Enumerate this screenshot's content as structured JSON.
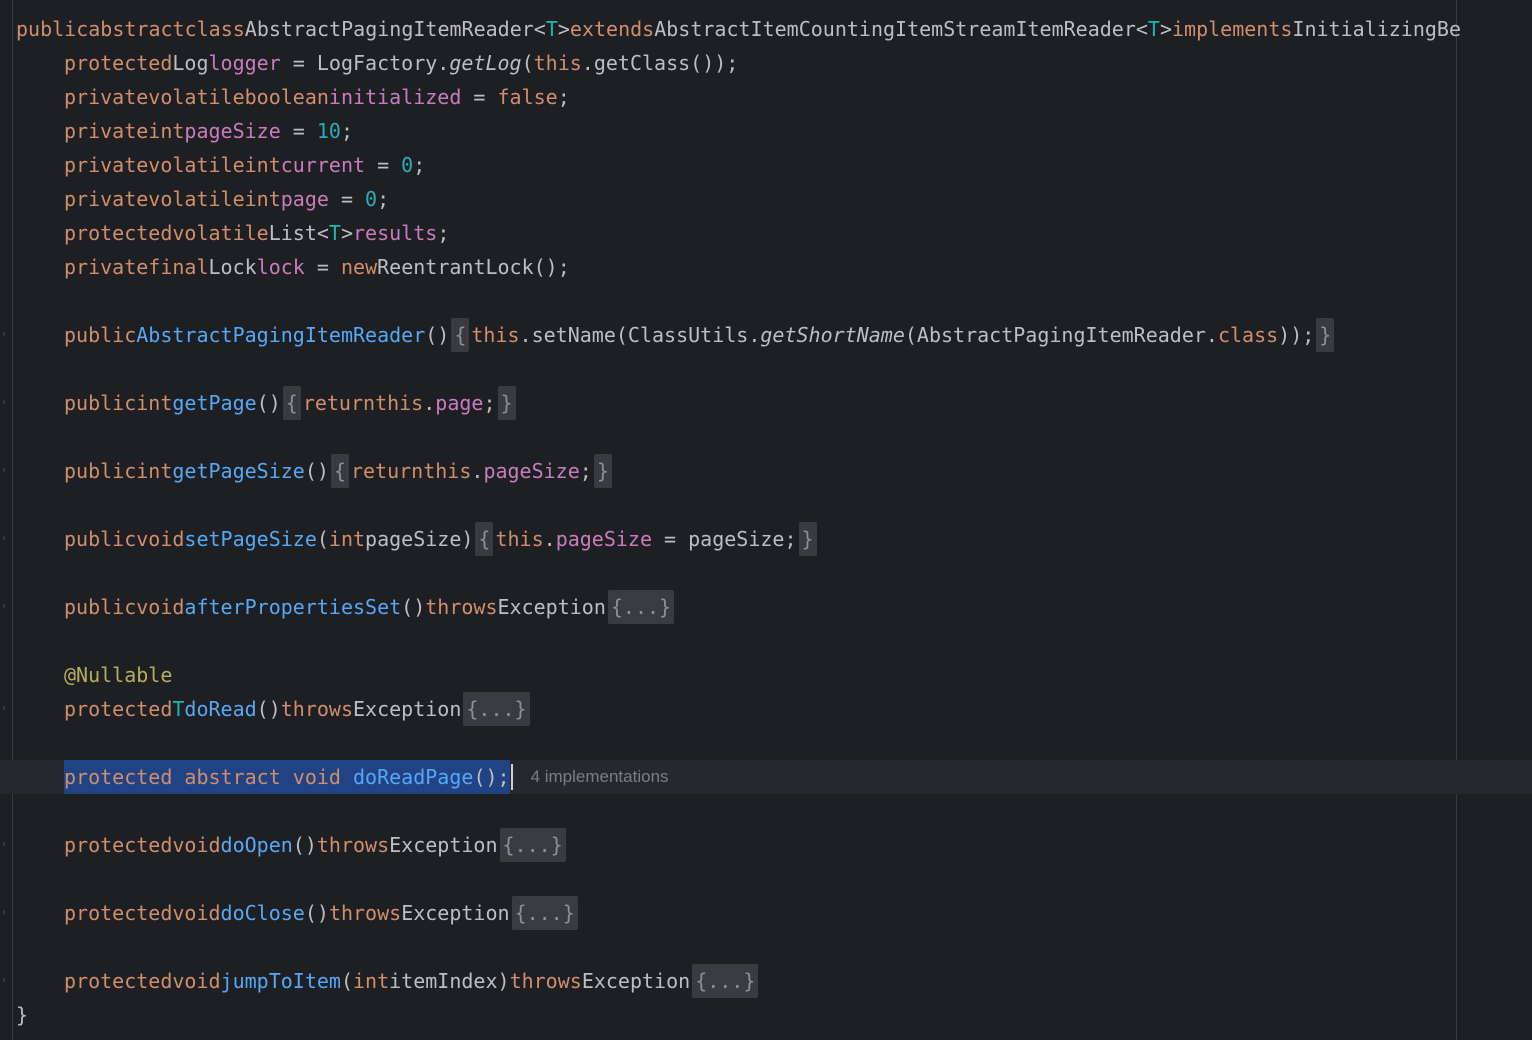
{
  "editor": {
    "class_header": {
      "public": "public",
      "abstract": "abstract",
      "class": "class",
      "class_name": "AbstractPagingItemReader",
      "lt": "<",
      "type_param": "T",
      "gt": ">",
      "extends": "extends",
      "super_name": "AbstractItemCountingItemStreamItemReader",
      "implements": "implements",
      "iface": "InitializingBe"
    },
    "fields": {
      "logger": {
        "mod": "protected",
        "type": "Log",
        "name": "logger",
        "eq": " = ",
        "factory": "LogFactory.",
        "method": "getLog",
        "open": "(",
        "this_kw": "this",
        "rest": ".getClass());"
      },
      "initialized": {
        "mod1": "private",
        "mod2": "volatile",
        "type": "boolean",
        "name": "initialized",
        "eq": " = ",
        "value": "false",
        "semi": ";"
      },
      "page_size": {
        "mod": "private",
        "type": "int",
        "name": "pageSize",
        "eq": " = ",
        "value": "10",
        "semi": ";"
      },
      "current": {
        "mod1": "private",
        "mod2": "volatile",
        "type": "int",
        "name": "current",
        "eq": " = ",
        "value": "0",
        "semi": ";"
      },
      "page": {
        "mod1": "private",
        "mod2": "volatile",
        "type": "int",
        "name": "page",
        "eq": " = ",
        "value": "0",
        "semi": ";"
      },
      "results": {
        "mod1": "protected",
        "mod2": "volatile",
        "type": "List",
        "lt": "<",
        "tp": "T",
        "gt": ">",
        "name": "results",
        "semi": ";"
      },
      "lock": {
        "mod1": "private",
        "mod2": "final",
        "type": "Lock",
        "name": "lock",
        "eq": " = ",
        "new_kw": "new",
        "rest": "ReentrantLock();"
      }
    },
    "methods": {
      "ctor": {
        "mod": "public",
        "name": "AbstractPagingItemReader",
        "parens": "()",
        "open_brace": "{",
        "this_kw": "this",
        "call": ".setName(ClassUtils.",
        "static_fn": "getShortName",
        "arg": "(AbstractPagingItemReader.",
        "class_kw": "class",
        "close": "));",
        "close_brace": "}"
      },
      "get_page": {
        "mod": "public",
        "type": "int",
        "name": "getPage",
        "parens": "()",
        "open_brace": "{",
        "return_kw": "return",
        "this_kw": "this",
        "dot": ".",
        "field": "page",
        "semi": ";",
        "close_brace": "}"
      },
      "get_page_size": {
        "mod": "public",
        "type": "int",
        "name": "getPageSize",
        "parens": "()",
        "open_brace": "{",
        "return_kw": "return",
        "this_kw": "this",
        "dot": ".",
        "field": "pageSize",
        "semi": ";",
        "close_brace": "}"
      },
      "set_page_size": {
        "mod": "public",
        "type": "void",
        "name": "setPageSize",
        "open_paren": "(",
        "param_type": "int",
        "param": "pageSize)",
        "open_brace": "{",
        "this_kw": "this",
        "dot": ".",
        "field": "pageSize",
        "assign": " = pageSize;",
        "close_brace": "}"
      },
      "after_props": {
        "mod": "public",
        "type": "void",
        "name": "afterPropertiesSet",
        "parens": "()",
        "throws": "throws",
        "exc": "Exception",
        "folded": "{...}"
      },
      "do_read": {
        "annotation": "@Nullable",
        "mod": "protected",
        "type": "T",
        "name": "doRead",
        "parens": "()",
        "throws": "throws",
        "exc": "Exception",
        "folded": "{...}"
      },
      "do_read_page": {
        "mod1": "protected",
        "mod2": "abstract",
        "type": "void",
        "name": "doReadPage",
        "rest": "();",
        "hint": "4 implementations"
      },
      "do_open": {
        "mod": "protected",
        "type": "void",
        "name": "doOpen",
        "parens": "()",
        "throws": "throws",
        "exc": "Exception",
        "folded": "{...}"
      },
      "do_close": {
        "mod": "protected",
        "type": "void",
        "name": "doClose",
        "parens": "()",
        "throws": "throws",
        "exc": "Exception",
        "folded": "{...}"
      },
      "jump_to_item": {
        "mod": "protected",
        "type": "void",
        "name": "jumpToItem",
        "open_paren": "(",
        "param_type": "int",
        "param": "itemIndex)",
        "throws": "throws",
        "exc": "Exception",
        "folded": "{...}"
      }
    },
    "closing_brace": "}",
    "fold_glyph": "›"
  }
}
